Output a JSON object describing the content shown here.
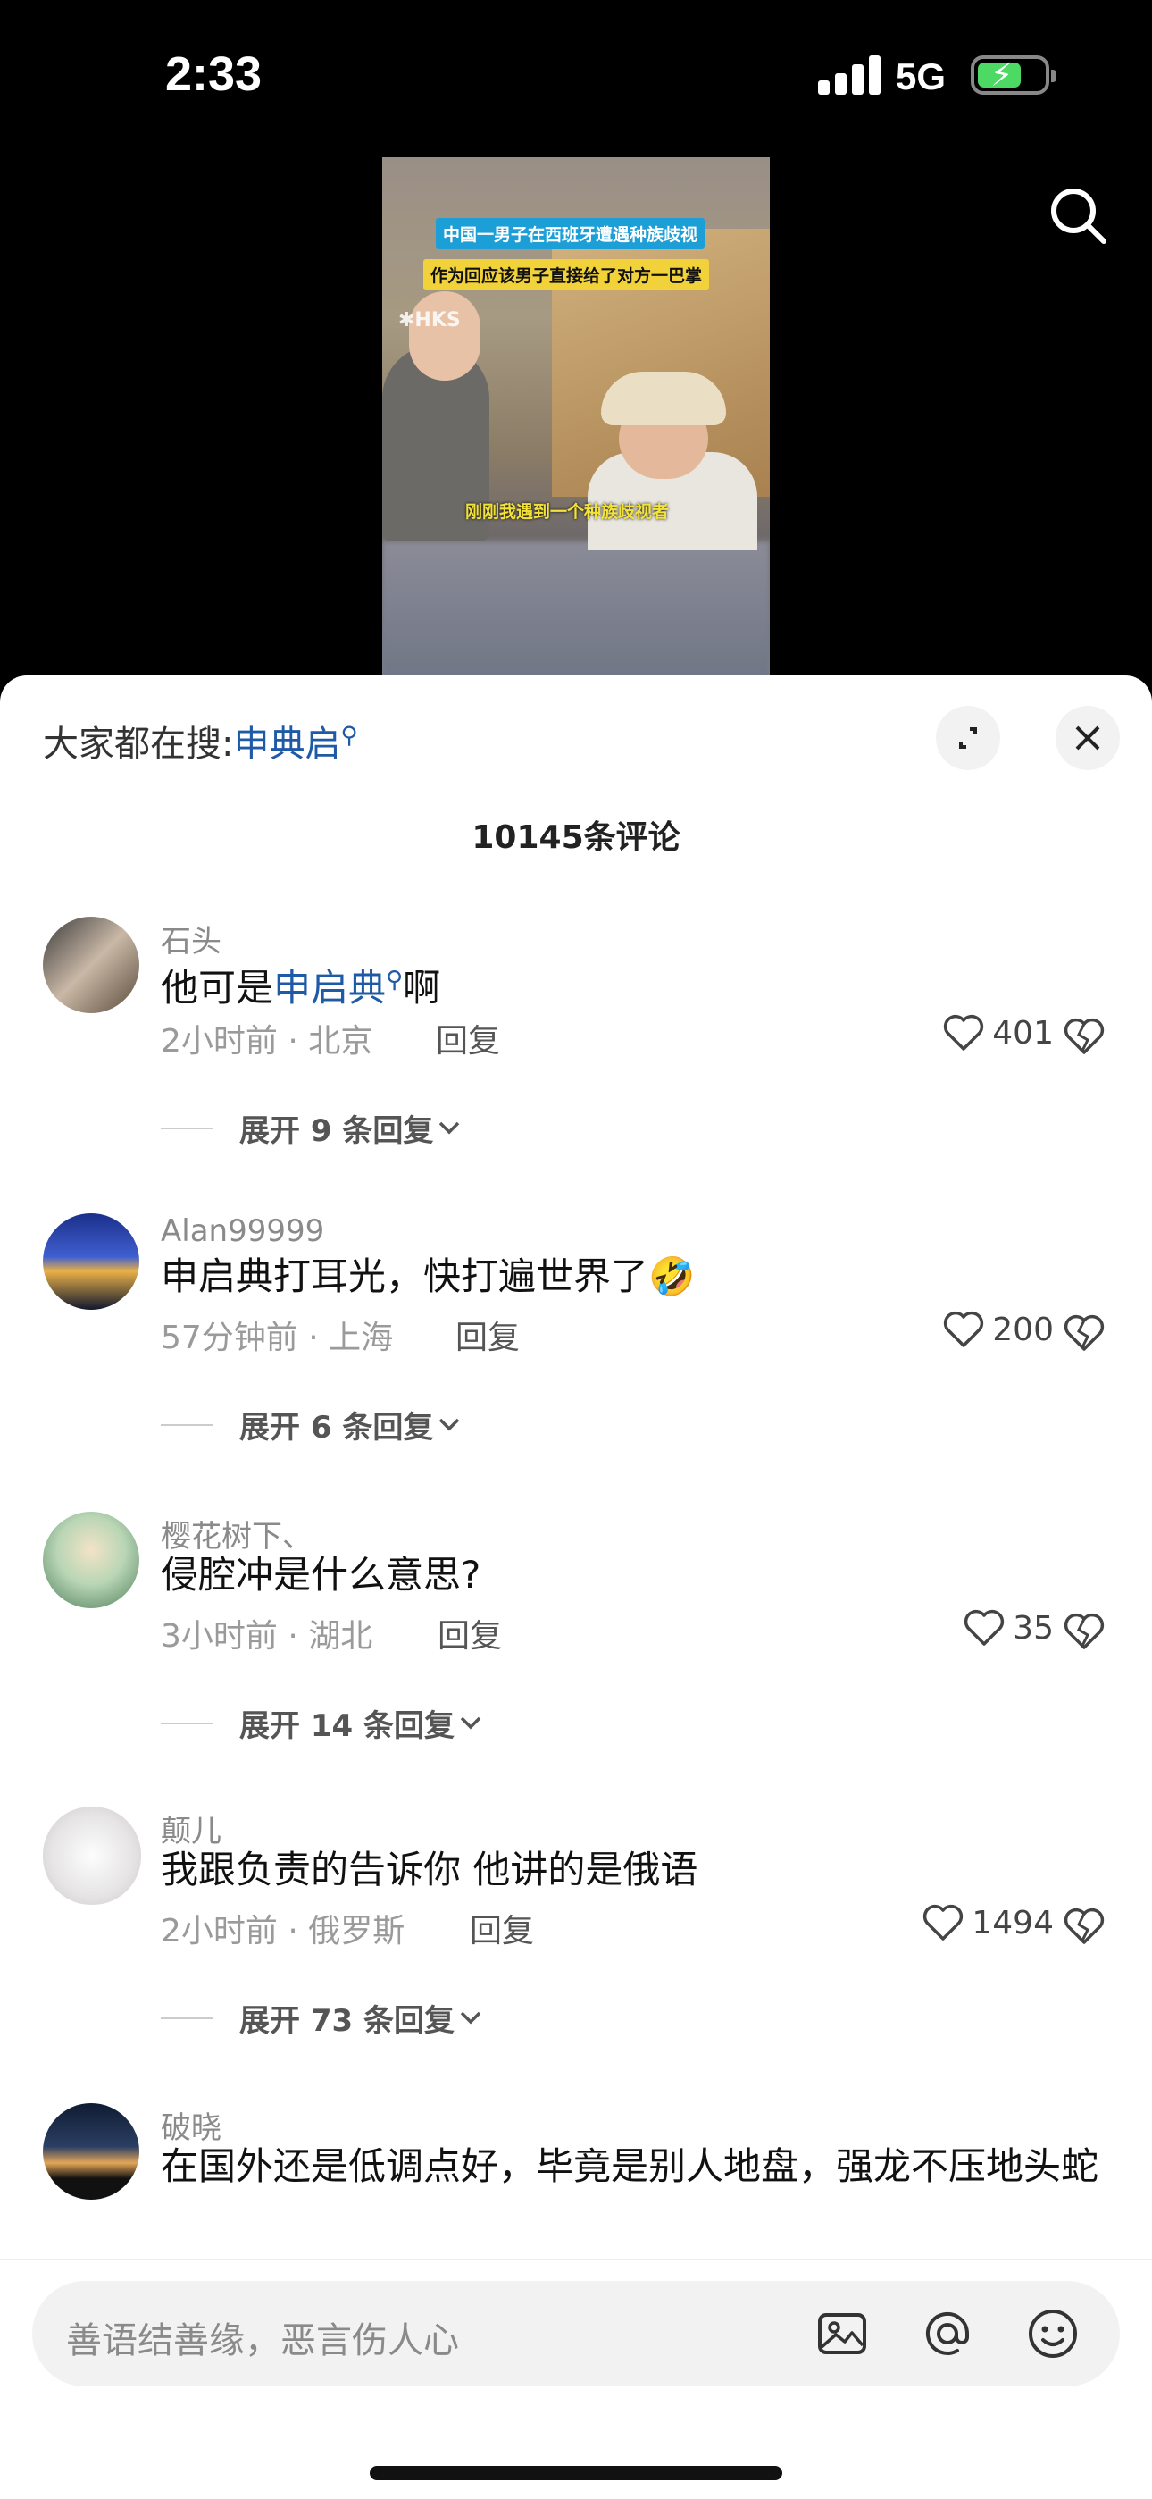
{
  "status_bar": {
    "time": "2:33",
    "network": "5G"
  },
  "video": {
    "caption_line1": "中国一男子在西班牙遭遇种族歧视",
    "caption_line2": "作为回应该男子直接给了对方一巴掌",
    "subtitle": "刚刚我遇到一个种族歧视者"
  },
  "sheet": {
    "hot_search_prefix": "大家都在搜:",
    "hot_search_keyword": "申典启",
    "comment_count": "10145条评论"
  },
  "comments": [
    {
      "user": "石头",
      "text_before": "他可是",
      "keyword": "申启典",
      "text_after": "啊",
      "time": "2小时前 · 北京",
      "reply": "回复",
      "likes": "401",
      "expand": "展开 9 条回复"
    },
    {
      "user": "Alan99999",
      "text": "申启典打耳光，快打遍世界了",
      "emoji": "🤣",
      "time": "57分钟前 · 上海",
      "reply": "回复",
      "likes": "200",
      "expand": "展开 6 条回复"
    },
    {
      "user": "樱花树下、",
      "text": "侵腔冲是什么意思?",
      "time": "3小时前 · 湖北",
      "reply": "回复",
      "likes": "35",
      "expand": "展开 14 条回复"
    },
    {
      "user": "颠儿",
      "text": "我跟负责的告诉你 他讲的是俄语",
      "time": "2小时前 · 俄罗斯",
      "reply": "回复",
      "likes": "1494",
      "expand": "展开 73 条回复"
    },
    {
      "user": "破晓",
      "text": "在国外还是低调点好，毕竟是别人地盘，强龙不压地头蛇"
    }
  ],
  "input": {
    "placeholder": "善语结善缘，恶言伤人心"
  },
  "colors": {
    "keyword": "#1f5aa6",
    "battery": "#4cd964"
  },
  "icons": [
    "search-icon",
    "expand-icon",
    "close-icon",
    "heart-icon",
    "dislike-icon",
    "image-icon",
    "at-icon",
    "emoji-icon",
    "chevron-down-icon"
  ]
}
